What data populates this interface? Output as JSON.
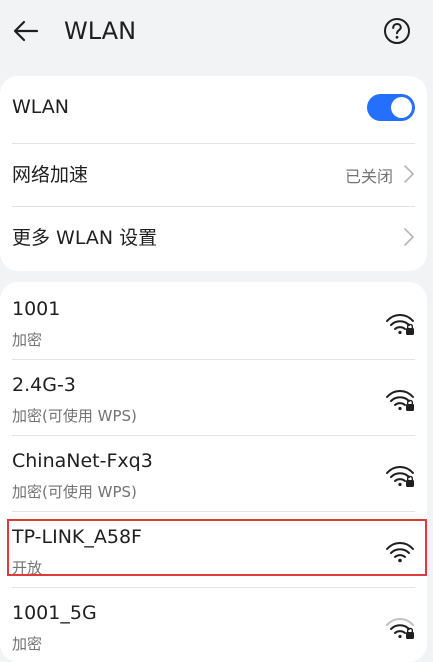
{
  "header": {
    "title": "WLAN",
    "back_icon": "back-arrow-icon",
    "help_icon": "help-circle-icon"
  },
  "settings": {
    "wlan": {
      "label": "WLAN",
      "enabled": true
    },
    "acceleration": {
      "label": "网络加速",
      "value": "已关闭"
    },
    "more": {
      "label": "更多 WLAN 设置"
    }
  },
  "networks": [
    {
      "name": "1001",
      "status": "加密",
      "locked": true
    },
    {
      "name": "2.4G-3",
      "status": "加密(可使用 WPS)",
      "locked": true
    },
    {
      "name": "ChinaNet-Fxq3",
      "status": "加密(可使用 WPS)",
      "locked": true
    },
    {
      "name": "TP-LINK_A58F",
      "status": "开放",
      "locked": false,
      "highlighted": true
    },
    {
      "name": "1001_5G",
      "status": "加密",
      "locked": true
    }
  ],
  "colors": {
    "accent": "#256fff",
    "highlight_border": "#e03b3b",
    "background": "#f1f3f5"
  }
}
